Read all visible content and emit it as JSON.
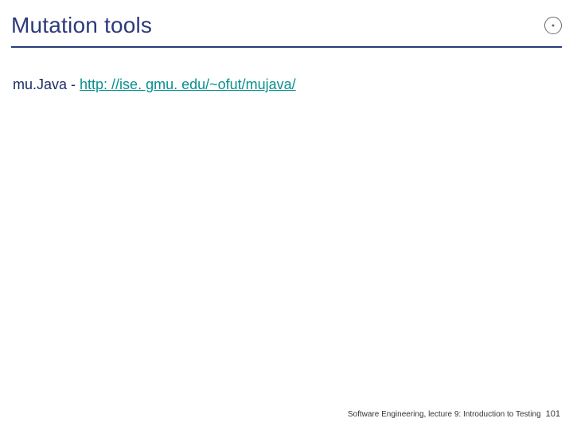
{
  "header": {
    "title": "Mutation tools"
  },
  "body": {
    "tool_name": "mu.Java ",
    "separator": "- ",
    "link_text": "http: //ise. gmu. edu/~ofut/mujava/",
    "link_href": "http://ise.gmu.edu/~ofut/mujava/"
  },
  "footer": {
    "text": "Software Engineering, lecture 9: Introduction to Testing",
    "page": "101"
  }
}
